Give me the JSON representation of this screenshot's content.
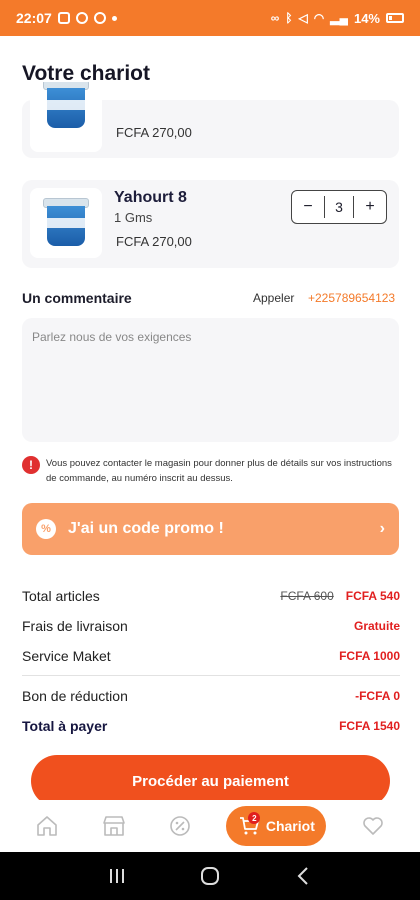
{
  "status_bar": {
    "time": "22:07",
    "battery": "14%"
  },
  "page": {
    "title": "Votre chariot"
  },
  "cart_items": [
    {
      "name": "",
      "sub": "",
      "price": "FCFA 270,00"
    },
    {
      "name": "Yahourt 8",
      "sub": "1 Gms",
      "price": "FCFA 270,00",
      "quantity": "3",
      "minus": "−",
      "plus": "+"
    }
  ],
  "comment": {
    "label": "Un commentaire",
    "call_label": "Appeler",
    "phone": "+225789654123",
    "placeholder": "Parlez nous de vos exigences"
  },
  "info": {
    "icon": "!",
    "text": "Vous pouvez contacter le magasin pour donner plus de détails sur vos instructions de commande, au numéro inscrit au dessus."
  },
  "promo": {
    "icon": "%",
    "label": "J'ai un code promo !",
    "chevron": "›"
  },
  "summary": {
    "total_articles_label": "Total articles",
    "total_articles_old": "FCFA 600",
    "total_articles_new": "FCFA 540",
    "delivery_label": "Frais de livraison",
    "delivery_value": "Gratuite",
    "service_label": "Service Maket",
    "service_value": "FCFA 1000",
    "discount_label": "Bon de réduction",
    "discount_value": "-FCFA 0",
    "total_label": "Total à payer",
    "total_value": "FCFA 1540"
  },
  "pay_button": "Procéder au paiement",
  "bottom_nav": {
    "cart_label": "Chariot",
    "cart_badge": "2"
  },
  "colors": {
    "accent": "#f47a2a",
    "pay": "#f0501e",
    "promo": "#f9a06a",
    "price_red": "#e11f1f"
  }
}
